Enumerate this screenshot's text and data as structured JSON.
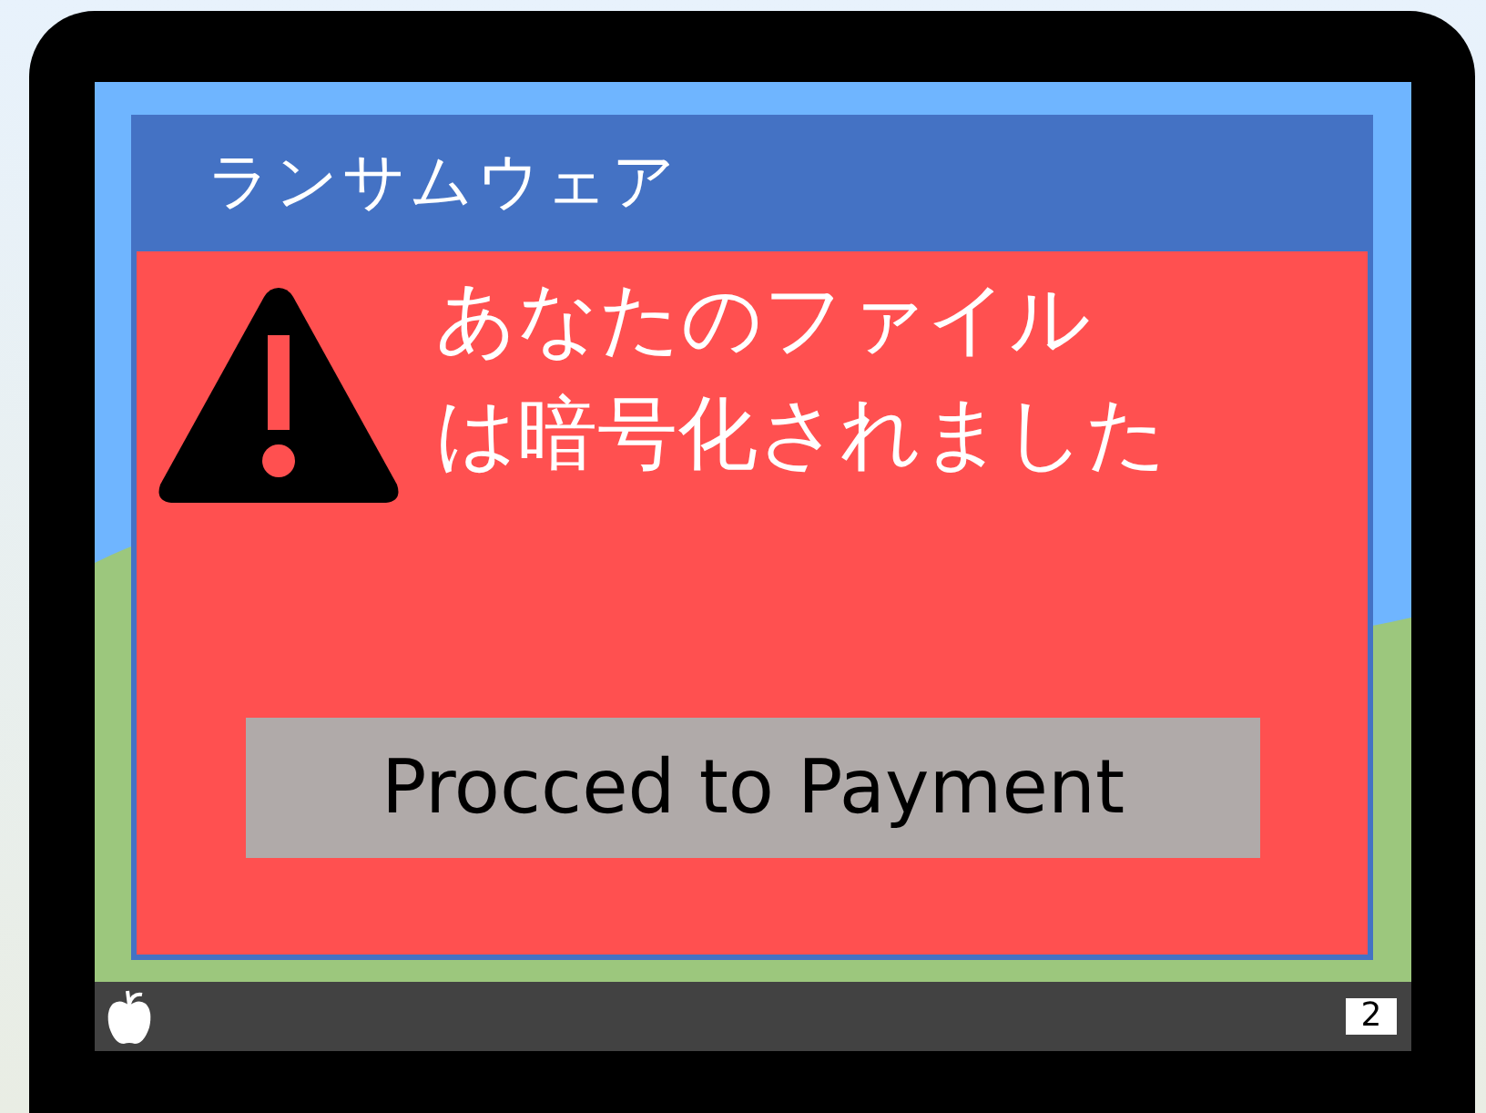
{
  "window": {
    "title": "ランサムウェア"
  },
  "message": "あなたのファイルは暗号化されました",
  "button": {
    "label": "Procced to Payment"
  },
  "taskbar": {
    "notification_count": "2"
  }
}
